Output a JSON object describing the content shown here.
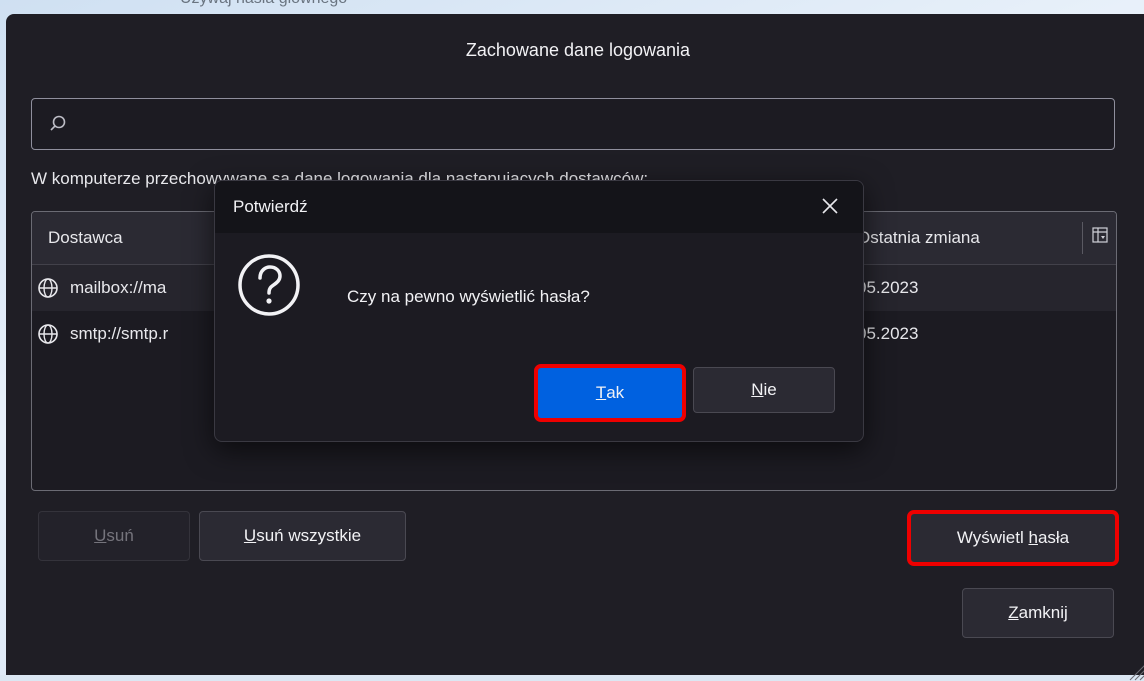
{
  "background": {
    "peek_text": "Uzywaj hasla glownego"
  },
  "window": {
    "title": "Zachowane dane logowania",
    "search": {
      "value": "",
      "placeholder": ""
    },
    "providers_label": "W komputerze przechowywane są dane logowania dla następujących dostawców:",
    "table": {
      "columns": [
        "Dostawca",
        "Ostatnia zmiana"
      ],
      "rows": [
        {
          "provider": "mailbox://ma",
          "date": "05.2023"
        },
        {
          "provider": "smtp://smtp.r",
          "date": "05.2023"
        }
      ]
    },
    "buttons": {
      "remove": {
        "pre": "",
        "key": "U",
        "post": "suń"
      },
      "remove_all": {
        "pre": "",
        "key": "U",
        "post": "suń wszystkie"
      },
      "show_passwords": {
        "pre": "Wyświetl ",
        "key": "h",
        "post": "asła"
      },
      "close": {
        "pre": "",
        "key": "Z",
        "post": "amknij"
      }
    }
  },
  "dialog": {
    "title": "Potwierdź",
    "message": "Czy na pewno wyświetlić hasła?",
    "yes": {
      "key": "T",
      "post": "ak"
    },
    "no": {
      "key": "N",
      "post": "ie"
    }
  },
  "colors": {
    "window_bg": "#1f1e25",
    "dialog_header": "#141419",
    "primary": "#0061e0",
    "highlight": "#ee0000"
  },
  "icons": {
    "search": "search-icon",
    "globe": "globe-icon",
    "close": "close-icon",
    "question": "question-icon",
    "column_picker": "column-picker-icon"
  }
}
